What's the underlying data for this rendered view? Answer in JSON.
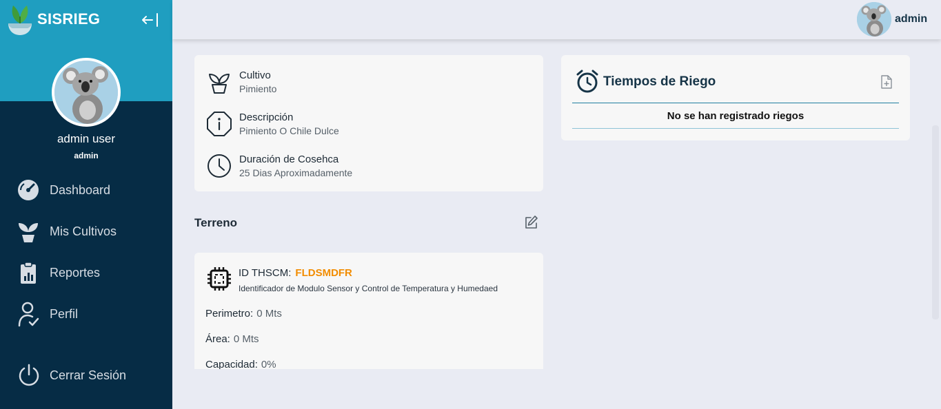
{
  "sidebar": {
    "brand": "SISRIEG",
    "user_name": "admin user",
    "user_role": "admin",
    "nav": [
      {
        "label": "Dashboard",
        "icon": "dashboard-gauge-icon"
      },
      {
        "label": "Mis Cultivos",
        "icon": "sprout-icon"
      },
      {
        "label": "Reportes",
        "icon": "clipboard-chart-icon"
      },
      {
        "label": "Perfil",
        "icon": "user-check-icon"
      }
    ],
    "logout": "Cerrar Sesión"
  },
  "header": {
    "user": "admin"
  },
  "cultivo": {
    "items": [
      {
        "title": "Cultivo",
        "value": "Pimiento",
        "icon": "plant-pot-icon"
      },
      {
        "title": "Descripción",
        "value": "Pimiento O Chile Dulce",
        "icon": "info-octagon-icon"
      },
      {
        "title": "Duración de Cosehca",
        "value": "25 Dias Aproximadamente",
        "icon": "clock-icon"
      }
    ]
  },
  "terreno": {
    "title": "Terreno",
    "id_label": "ID THSCM:",
    "id_value": "FLDSMDFR",
    "id_desc": "Identificador de Modulo Sensor y Control de Temperatura y Humedaed",
    "perimetro_label": "Perimetro:",
    "perimetro_value": "0 Mts",
    "area_label": "Área:",
    "area_value": "0 Mts",
    "capacidad_label": "Capacidad:",
    "capacidad_value": "0%"
  },
  "riego": {
    "title": "Tiempos de Riego",
    "empty": "No se han registrado riegos"
  },
  "colors": {
    "sidebar_dark": "#062c45",
    "sidebar_accent": "#1f9ec0",
    "id_orange": "#f28c00",
    "background": "#e9ebf3"
  }
}
